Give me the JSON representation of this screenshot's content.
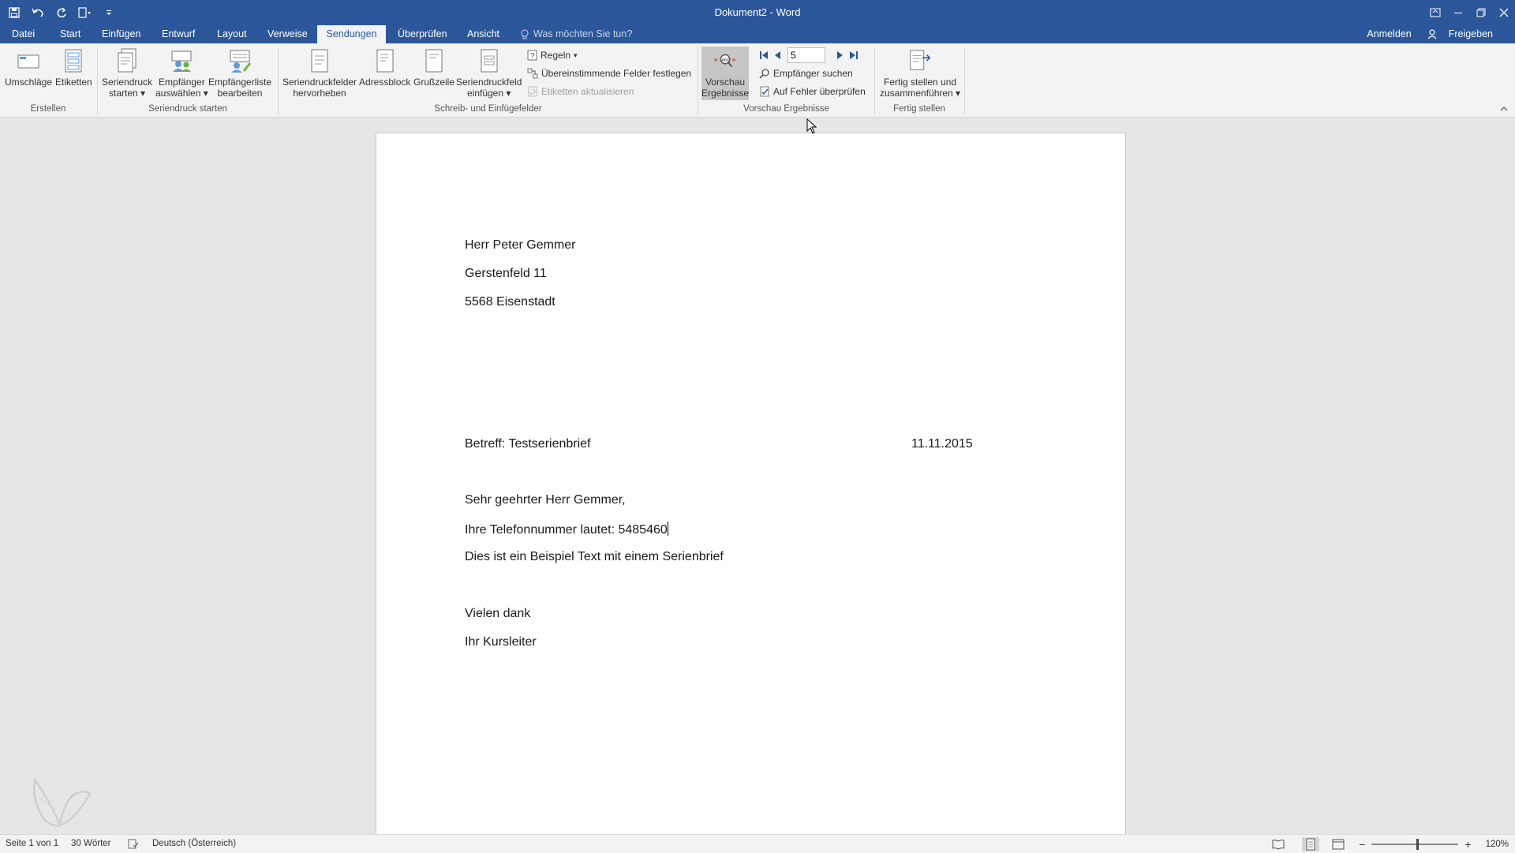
{
  "window": {
    "title": "Dokument2 - Word"
  },
  "qat": {
    "save": "save-icon",
    "undo": "undo-icon",
    "redo": "redo-icon",
    "touch": "touch-mode-icon",
    "customize": "customize-icon"
  },
  "tabs": [
    {
      "label": "Datei"
    },
    {
      "label": "Start"
    },
    {
      "label": "Einfügen"
    },
    {
      "label": "Entwurf"
    },
    {
      "label": "Layout"
    },
    {
      "label": "Verweise"
    },
    {
      "label": "Sendungen"
    },
    {
      "label": "Überprüfen"
    },
    {
      "label": "Ansicht"
    }
  ],
  "active_tab": "Sendungen",
  "tellme": {
    "placeholder": "Was möchten Sie tun?"
  },
  "account": {
    "signin": "Anmelden",
    "share": "Freigeben"
  },
  "ribbon": {
    "erstellen": {
      "label": "Erstellen",
      "umschlaege": "Umschläge",
      "etiketten": "Etiketten"
    },
    "seriendruck_starten": {
      "label": "Seriendruck starten",
      "seriendruck_l1": "Seriendruck",
      "seriendruck_l2": "starten",
      "empfaenger_l1": "Empfänger",
      "empfaenger_l2": "auswählen",
      "empfaengerliste_l1": "Empfängerliste",
      "empfaengerliste_l2": "bearbeiten"
    },
    "schreib": {
      "label": "Schreib- und Einfügefelder",
      "hervorheben_l1": "Seriendruckfelder",
      "hervorheben_l2": "hervorheben",
      "adressblock": "Adressblock",
      "grusszeile": "Grußzeile",
      "feld_l1": "Seriendruckfeld",
      "feld_l2": "einfügen",
      "regeln": "Regeln",
      "felder_festlegen": "Übereinstimmende Felder festlegen",
      "etiketten_aktualisieren": "Etiketten aktualisieren"
    },
    "vorschau": {
      "label": "Vorschau Ergebnisse",
      "vorschau_l1": "Vorschau",
      "vorschau_l2": "Ergebnisse",
      "record": "5",
      "empfaenger_suchen": "Empfänger suchen",
      "fehler_pruefen": "Auf Fehler überprüfen"
    },
    "fertig": {
      "label": "Fertig stellen",
      "fertig_l1": "Fertig stellen und",
      "fertig_l2": "zusammenführen"
    }
  },
  "document": {
    "address": [
      "Herr Peter Gemmer",
      "Gerstenfeld 11",
      "5568 Eisenstadt"
    ],
    "subject": "Betreff: Testserienbrief",
    "date": "11.11.2015",
    "salutation": "Sehr geehrter Herr Gemmer,",
    "phone_line": "Ihre Telefonnummer lautet: 5485460",
    "body": "Dies ist ein Beispiel Text mit einem Serienbrief",
    "closing": "Vielen dank",
    "signature": "Ihr Kursleiter"
  },
  "status": {
    "page": "Seite 1 von 1",
    "words": "30 Wörter",
    "language": "Deutsch (Österreich)",
    "zoom": "120%",
    "zoom_level": 1.2
  },
  "colors": {
    "brand": "#2b579a",
    "ribbon_bg": "#f3f3f3",
    "canvas_bg": "#e6e6e6"
  }
}
